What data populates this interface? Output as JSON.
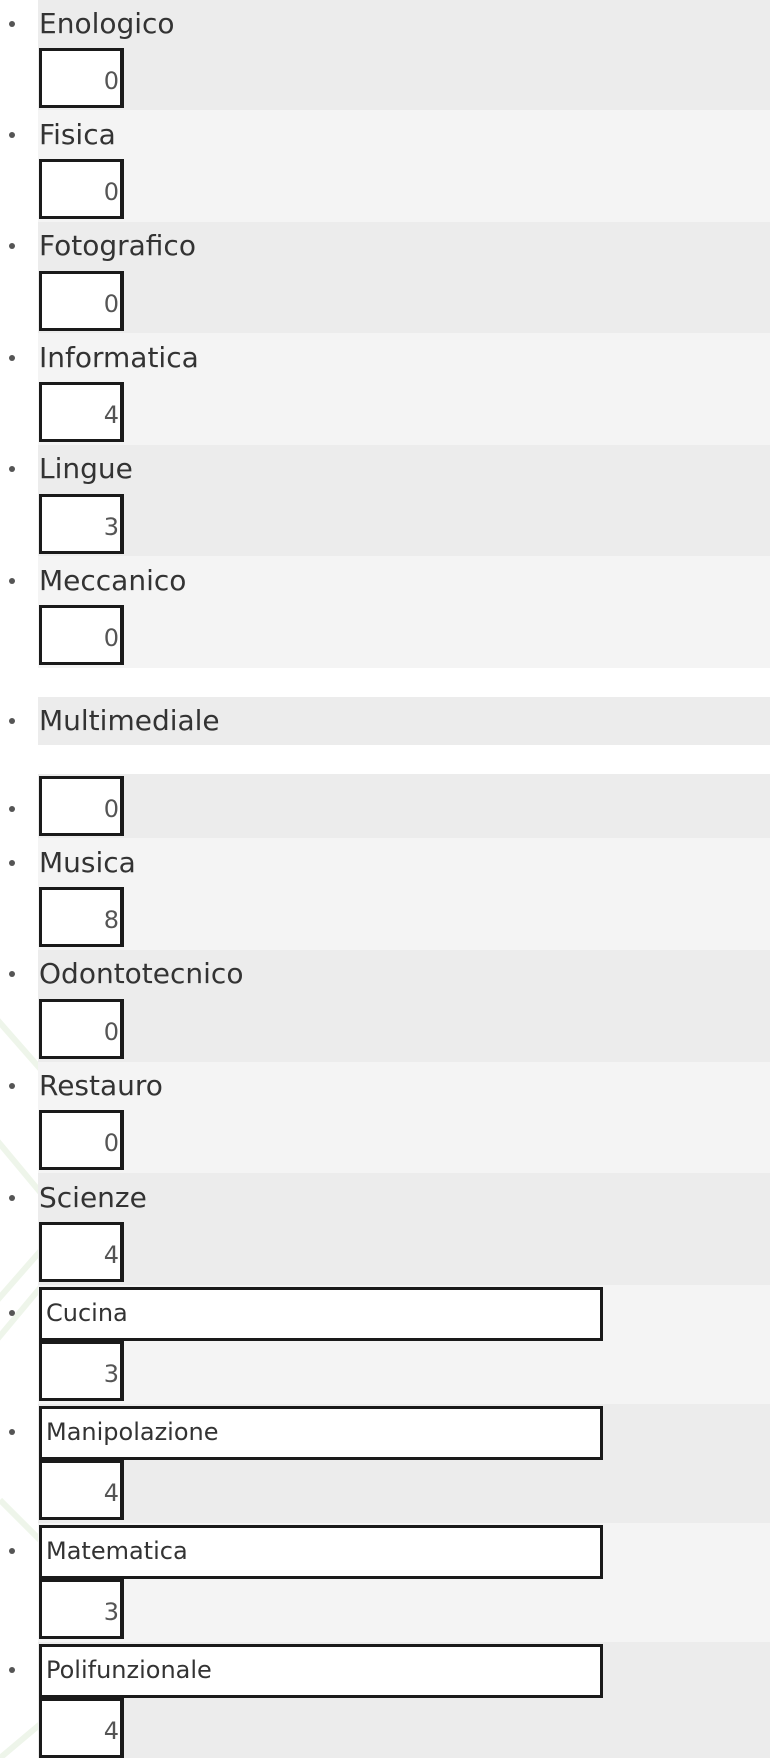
{
  "items": [
    {
      "label": "Enologico",
      "value": "0"
    },
    {
      "label": "Fisica",
      "value": "0"
    },
    {
      "label": "Fotografico",
      "value": "0"
    },
    {
      "label": "Informatica",
      "value": "4"
    },
    {
      "label": "Lingue",
      "value": "3"
    },
    {
      "label": "Meccanico",
      "value": "0"
    },
    {
      "label": "Multimediale",
      "value": "0"
    },
    {
      "label": "Musica",
      "value": "8"
    },
    {
      "label": "Odontotecnico",
      "value": "0"
    },
    {
      "label": "Restauro",
      "value": "0"
    },
    {
      "label": "Scienze",
      "value": "4"
    }
  ],
  "custom_items": [
    {
      "label": "Cucina",
      "value": "3"
    },
    {
      "label": "Manipolazione",
      "value": "4"
    },
    {
      "label": "Matematica",
      "value": "3"
    },
    {
      "label": "Polifunzionale",
      "value": "4"
    }
  ]
}
